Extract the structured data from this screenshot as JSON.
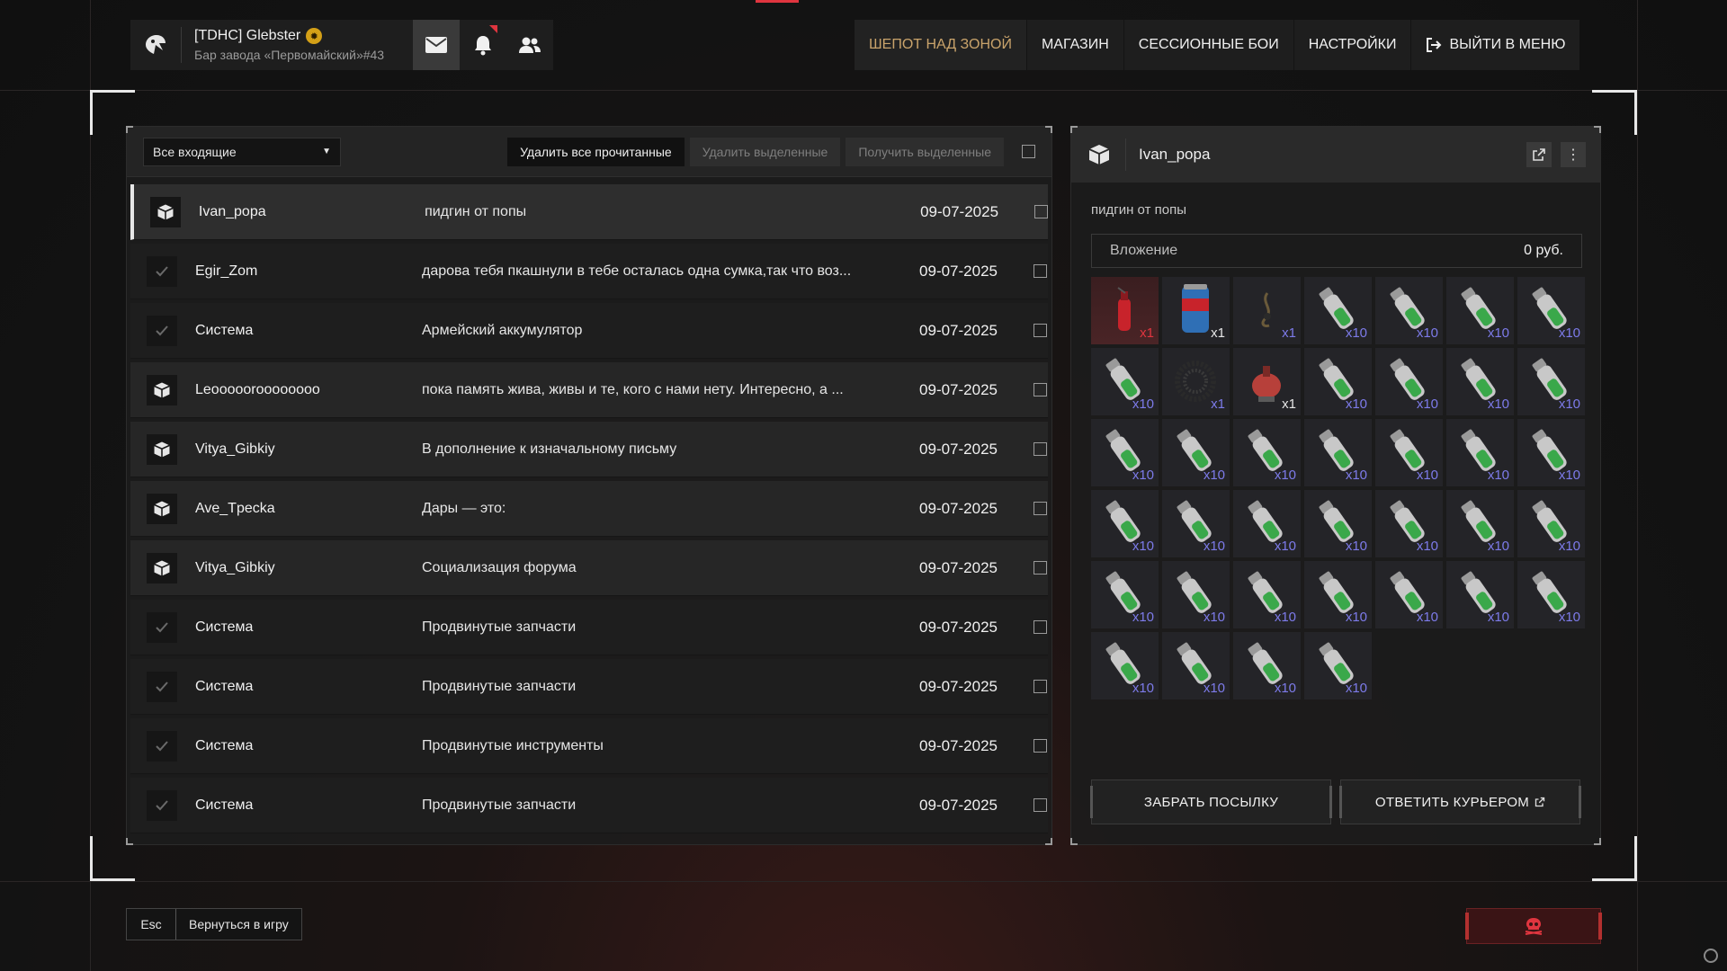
{
  "profile": {
    "name": "[TDHC] Glebster",
    "status": "Бар завода «Первомайский»#43",
    "icons": [
      "logo-icon",
      "clan-badge-icon",
      "mail-icon",
      "bell-icon",
      "friends-icon"
    ]
  },
  "nav": {
    "items": [
      {
        "label": "ШЕПОТ НАД ЗОНОЙ",
        "active": true
      },
      {
        "label": "МАГАЗИН",
        "active": false
      },
      {
        "label": "СЕССИОННЫЕ БОИ",
        "active": false
      },
      {
        "label": "НАСТРОЙКИ",
        "active": false
      },
      {
        "label": "ВЫЙТИ В МЕНЮ",
        "active": false,
        "icon": "logout-icon"
      }
    ]
  },
  "inbox": {
    "filter_value": "Все входящие",
    "delete_read_label": "Удалить все прочитанные",
    "delete_selected_label": "Удалить выделенные",
    "get_selected_label": "Получить выделенные",
    "rows": [
      {
        "icon": "package-icon",
        "sender": "Ivan_popa",
        "subject": "пидгин от попы",
        "date": "09-07-2025",
        "state": "selected"
      },
      {
        "icon": "check-icon",
        "sender": "Egir_Zom",
        "subject": "дарова тебя пкашнули в тебе осталась одна сумка,так что воз...",
        "date": "09-07-2025",
        "state": "read"
      },
      {
        "icon": "check-icon",
        "sender": "Система",
        "subject": "Армейский аккумулятор",
        "date": "09-07-2025",
        "state": "read"
      },
      {
        "icon": "package-icon",
        "sender": "Leoooooroooooooo",
        "subject": " пока память жива, живы и те, кого с нами нету. Интересно, а ...",
        "date": "09-07-2025",
        "state": "unread"
      },
      {
        "icon": "package-icon",
        "sender": "Vitya_Gibkiy",
        "subject": "В дополнение к изначальному письму",
        "date": "09-07-2025",
        "state": "unread"
      },
      {
        "icon": "package-icon",
        "sender": "Ave_Tpecka",
        "subject": "Дары — это:",
        "date": "09-07-2025",
        "state": "unread"
      },
      {
        "icon": "package-icon",
        "sender": "Vitya_Gibkiy",
        "subject": "Социализация форума",
        "date": "09-07-2025",
        "state": "unread"
      },
      {
        "icon": "check-icon",
        "sender": "Система",
        "subject": "Продвинутые запчасти",
        "date": "09-07-2025",
        "state": "read"
      },
      {
        "icon": "check-icon",
        "sender": "Система",
        "subject": "Продвинутые запчасти",
        "date": "09-07-2025",
        "state": "read"
      },
      {
        "icon": "check-icon",
        "sender": "Система",
        "subject": "Продвинутые инструменты",
        "date": "09-07-2025",
        "state": "read"
      },
      {
        "icon": "check-icon",
        "sender": "Система",
        "subject": "Продвинутые запчасти",
        "date": "09-07-2025",
        "state": "read"
      }
    ]
  },
  "message": {
    "sender": "Ivan_popa",
    "subject": "пидгин от попы",
    "attachment_label": "Вложение",
    "attachment_value": "0 руб.",
    "items": [
      {
        "type": "extinguisher-icon",
        "qty": "x1",
        "rarity": "red"
      },
      {
        "type": "can-icon",
        "qty": "x1",
        "rarity": "white"
      },
      {
        "type": "wire-icon",
        "qty": "x1",
        "rarity": "purple"
      },
      {
        "type": "vial-icon",
        "qty": "x10",
        "rarity": "purple"
      },
      {
        "type": "vial-icon",
        "qty": "x10",
        "rarity": "purple"
      },
      {
        "type": "vial-icon",
        "qty": "x10",
        "rarity": "purple"
      },
      {
        "type": "vial-icon",
        "qty": "x10",
        "rarity": "purple"
      },
      {
        "type": "vial-icon",
        "qty": "x10",
        "rarity": "purple"
      },
      {
        "type": "coil-icon",
        "qty": "x1",
        "rarity": "purple"
      },
      {
        "type": "lamp-icon",
        "qty": "x1",
        "rarity": "white"
      },
      {
        "type": "vial-icon",
        "qty": "x10",
        "rarity": "purple"
      },
      {
        "type": "vial-icon",
        "qty": "x10",
        "rarity": "purple"
      },
      {
        "type": "vial-icon",
        "qty": "x10",
        "rarity": "purple"
      },
      {
        "type": "vial-icon",
        "qty": "x10",
        "rarity": "purple"
      },
      {
        "type": "vial-icon",
        "qty": "x10",
        "rarity": "purple"
      },
      {
        "type": "vial-icon",
        "qty": "x10",
        "rarity": "purple"
      },
      {
        "type": "vial-icon",
        "qty": "x10",
        "rarity": "purple"
      },
      {
        "type": "vial-icon",
        "qty": "x10",
        "rarity": "purple"
      },
      {
        "type": "vial-icon",
        "qty": "x10",
        "rarity": "purple"
      },
      {
        "type": "vial-icon",
        "qty": "x10",
        "rarity": "purple"
      },
      {
        "type": "vial-icon",
        "qty": "x10",
        "rarity": "purple"
      },
      {
        "type": "vial-icon",
        "qty": "x10",
        "rarity": "purple"
      },
      {
        "type": "vial-icon",
        "qty": "x10",
        "rarity": "purple"
      },
      {
        "type": "vial-icon",
        "qty": "x10",
        "rarity": "purple"
      },
      {
        "type": "vial-icon",
        "qty": "x10",
        "rarity": "purple"
      },
      {
        "type": "vial-icon",
        "qty": "x10",
        "rarity": "purple"
      },
      {
        "type": "vial-icon",
        "qty": "x10",
        "rarity": "purple"
      },
      {
        "type": "vial-icon",
        "qty": "x10",
        "rarity": "purple"
      },
      {
        "type": "vial-icon",
        "qty": "x10",
        "rarity": "purple"
      },
      {
        "type": "vial-icon",
        "qty": "x10",
        "rarity": "purple"
      },
      {
        "type": "vial-icon",
        "qty": "x10",
        "rarity": "purple"
      },
      {
        "type": "vial-icon",
        "qty": "x10",
        "rarity": "purple"
      },
      {
        "type": "vial-icon",
        "qty": "x10",
        "rarity": "purple"
      },
      {
        "type": "vial-icon",
        "qty": "x10",
        "rarity": "purple"
      },
      {
        "type": "vial-icon",
        "qty": "x10",
        "rarity": "purple"
      },
      {
        "type": "vial-icon",
        "qty": "x10",
        "rarity": "purple"
      },
      {
        "type": "vial-icon",
        "qty": "x10",
        "rarity": "purple"
      },
      {
        "type": "vial-icon",
        "qty": "x10",
        "rarity": "purple"
      },
      {
        "type": "vial-icon",
        "qty": "x10",
        "rarity": "purple"
      }
    ],
    "take_label": "ЗАБРАТЬ ПОСЫЛКУ",
    "reply_label": "ОТВЕТИТЬ КУРЬЕРОМ"
  },
  "footer": {
    "esc_key": "Esc",
    "esc_label": "Вернуться в игру",
    "danger_icon": "skull-icon"
  },
  "colors": {
    "accent_gold": "#c9a36b",
    "accent_red": "#e0353f",
    "qty_purple": "#7d7bea"
  }
}
